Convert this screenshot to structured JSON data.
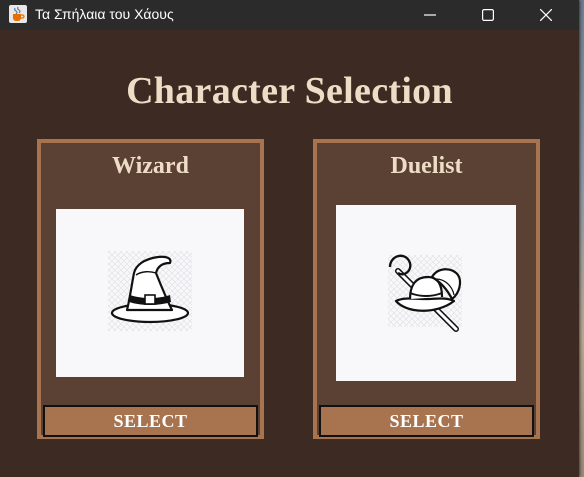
{
  "window": {
    "title": "Τα Σπήλαια του Χάους",
    "app_icon": "java-cup-icon",
    "controls": [
      "minimize-icon",
      "maximize-icon",
      "close-icon"
    ]
  },
  "screen": {
    "heading": "Character Selection"
  },
  "characters": [
    {
      "name": "Wizard",
      "portrait_icon": "wizard-hat-icon",
      "button_label": "SELECT"
    },
    {
      "name": "Duelist",
      "portrait_icon": "musketeer-hat-sword-icon",
      "button_label": "SELECT"
    }
  ],
  "colors": {
    "background": "#3d2a22",
    "card": "#5b4034",
    "card_border": "#a8734f",
    "button": "#a87450",
    "heading_text": "#eeddc6"
  }
}
